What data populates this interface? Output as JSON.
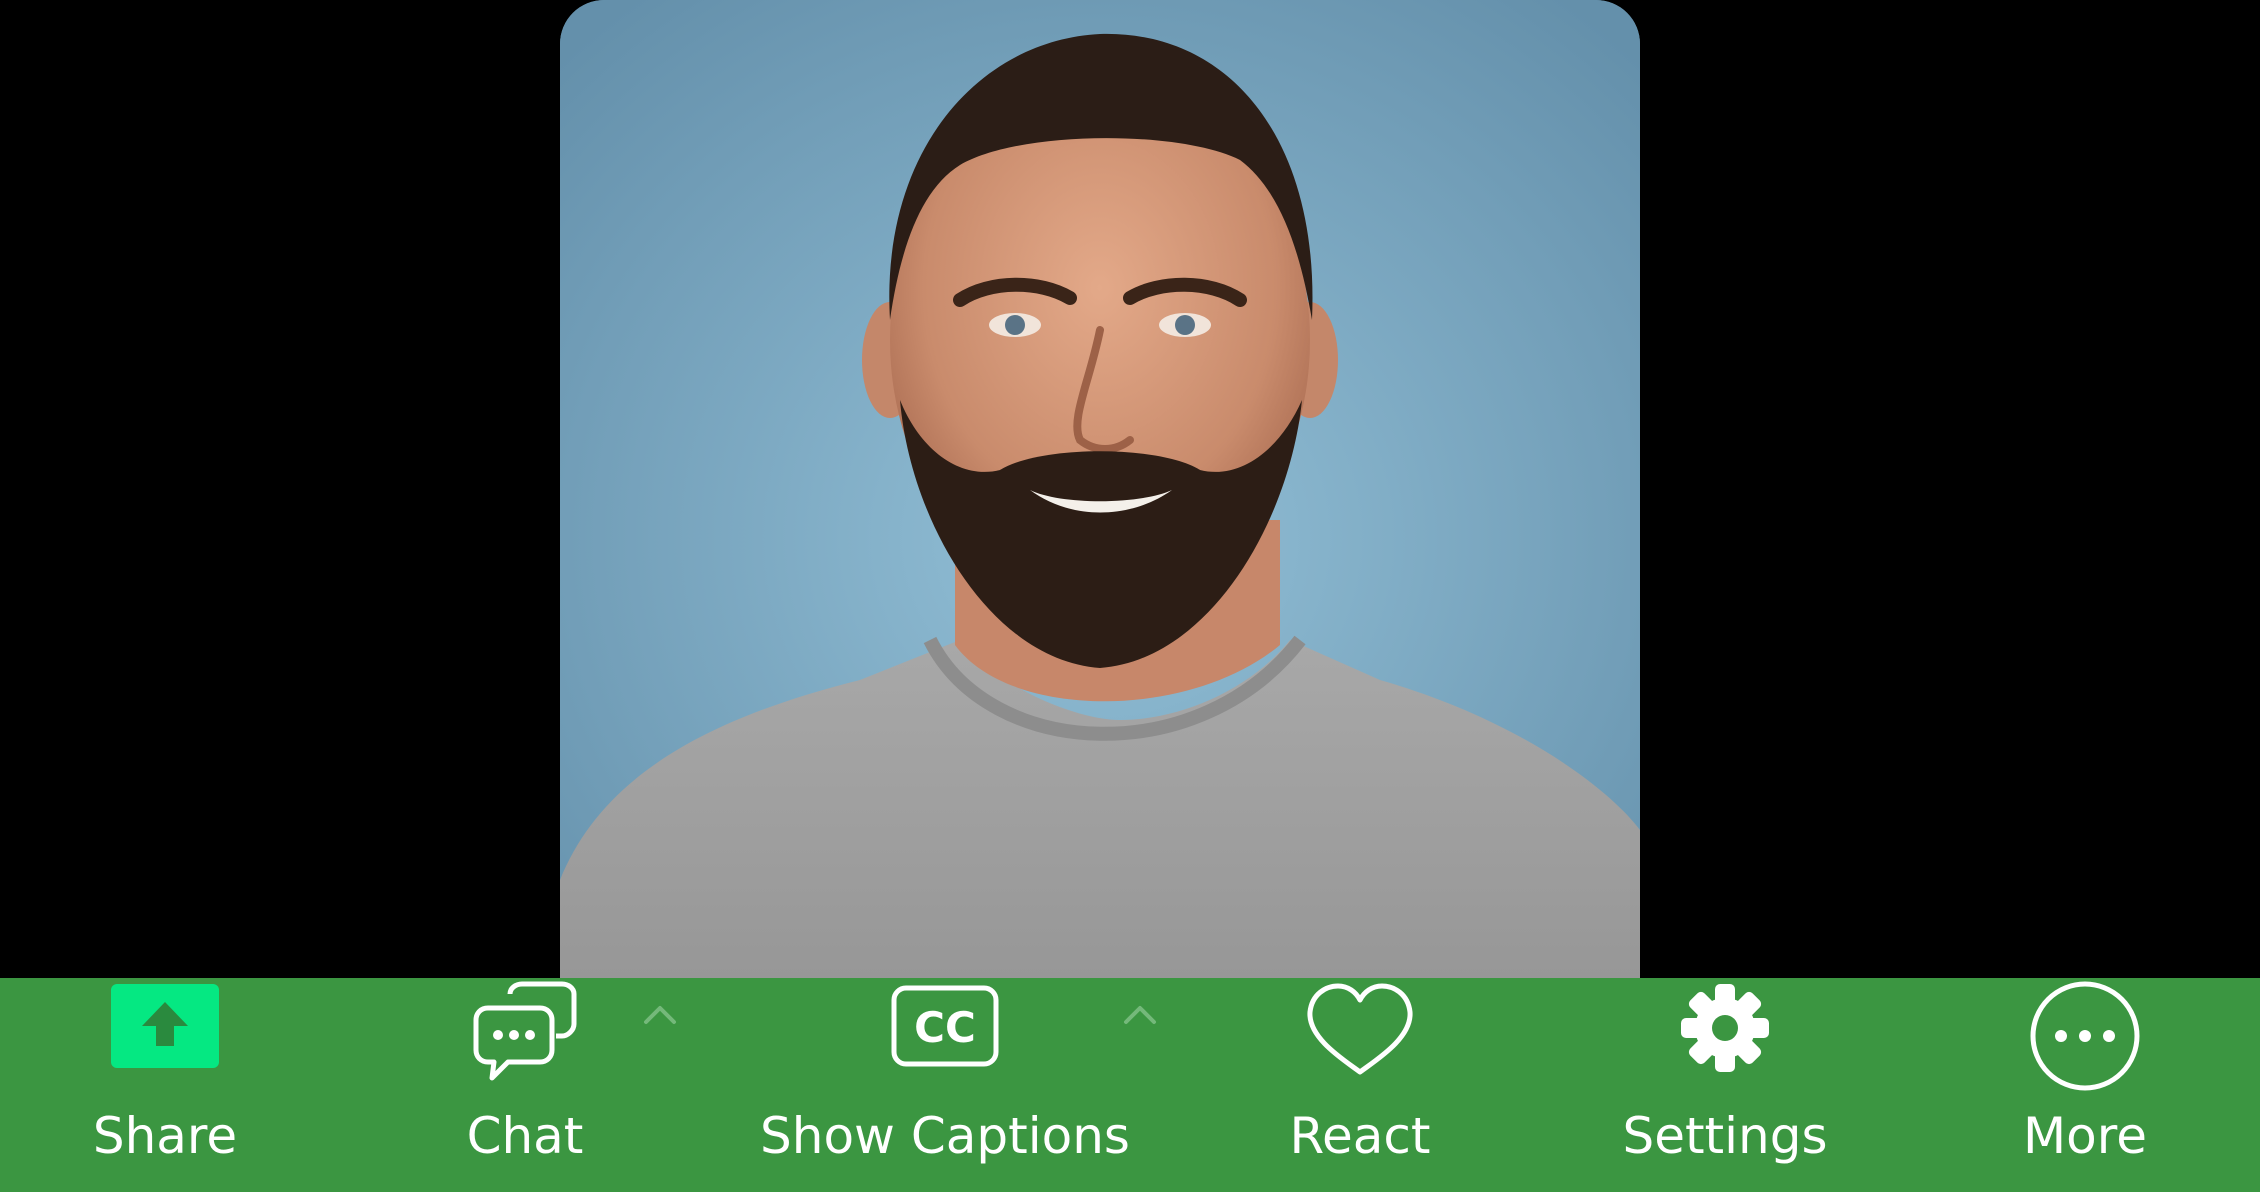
{
  "toolbar": {
    "buttons": [
      {
        "key": "share",
        "label": "Share",
        "icon": "share-upload-icon",
        "accent": "#05e882"
      },
      {
        "key": "chat",
        "label": "Chat",
        "icon": "chat-bubbles-icon"
      },
      {
        "key": "captions",
        "label": "Show Captions",
        "icon": "closed-captions-icon",
        "icon_text": "CC"
      },
      {
        "key": "react",
        "label": "React",
        "icon": "heart-icon"
      },
      {
        "key": "settings",
        "label": "Settings",
        "icon": "gear-icon"
      },
      {
        "key": "more",
        "label": "More",
        "icon": "more-dots-icon"
      }
    ],
    "carets": [
      "chevron-up-icon",
      "chevron-up-icon"
    ],
    "background": "#3b9641"
  },
  "video": {
    "participant": "man in grey t-shirt with beard",
    "background_color": "#7aa8c2"
  }
}
